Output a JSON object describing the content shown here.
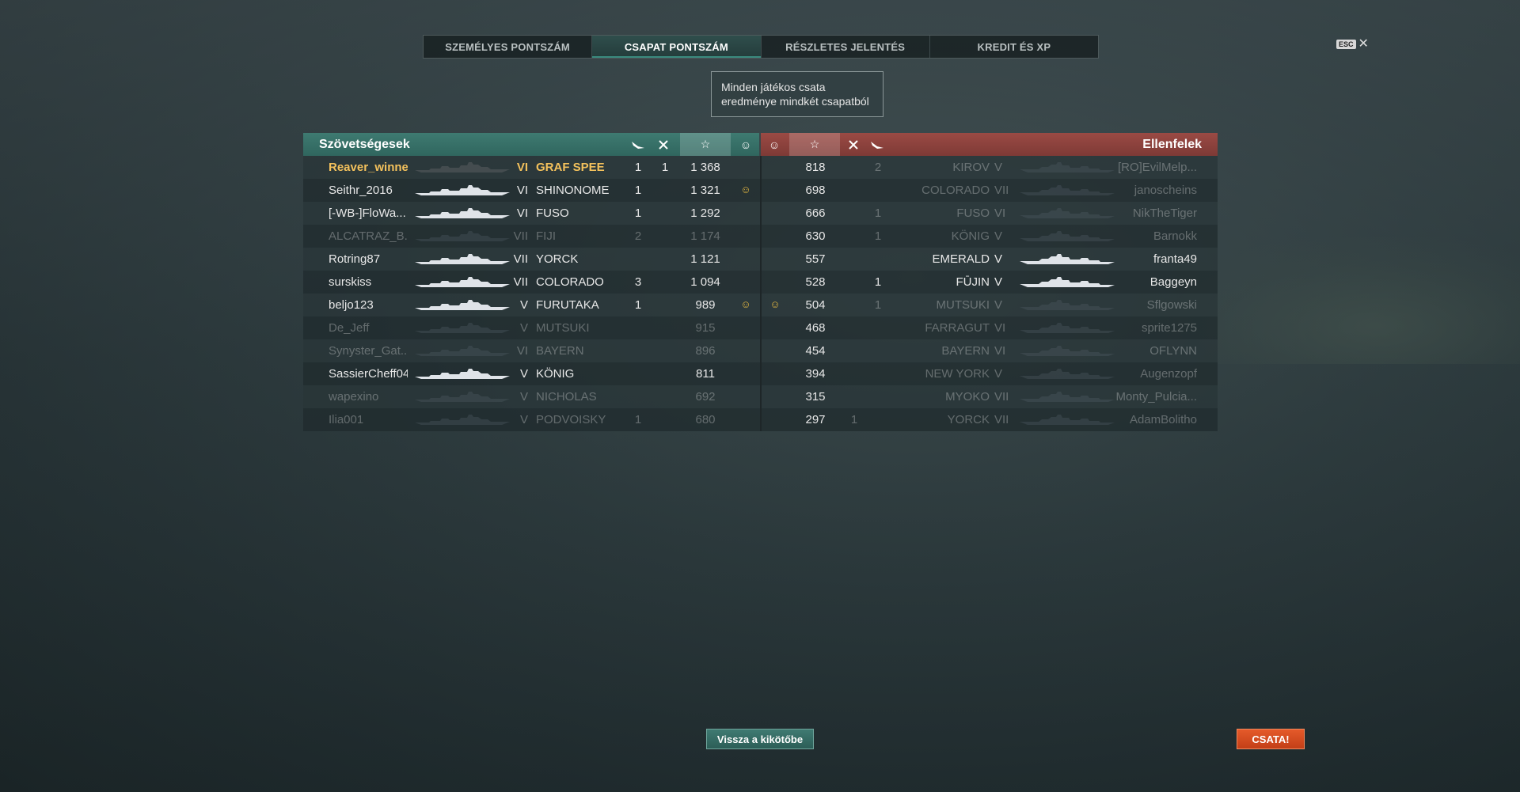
{
  "tabs": [
    {
      "label": "SZEMÉLYES PONTSZÁM",
      "active": false
    },
    {
      "label": "CSAPAT PONTSZÁM",
      "active": true
    },
    {
      "label": "RÉSZLETES JELENTÉS",
      "active": false
    },
    {
      "label": "KREDIT ÉS XP",
      "active": false
    }
  ],
  "esc": {
    "key": "ESC",
    "close": "✕"
  },
  "tooltip": "Minden játékos csata eredménye mindkét csapatból",
  "allies": {
    "title": "Szövetségesek",
    "rows": [
      {
        "player": "Reaver_winner",
        "tier": "VI",
        "ship": "GRAF SPEE",
        "planes": "1",
        "kills": "1",
        "xp": "1 368",
        "medal": "",
        "state": "me"
      },
      {
        "player": "Seithr_2016",
        "tier": "VI",
        "ship": "SHINONOME",
        "planes": "1",
        "kills": "",
        "xp": "1 321",
        "medal": "☺",
        "state": "alive"
      },
      {
        "player": "[-WB-]FloWa...",
        "tier": "VI",
        "ship": "FUSO",
        "planes": "1",
        "kills": "",
        "xp": "1 292",
        "medal": "",
        "state": "alive"
      },
      {
        "player": "ALCATRAZ_B...",
        "tier": "VII",
        "ship": "FIJI",
        "planes": "2",
        "kills": "",
        "xp": "1 174",
        "medal": "",
        "state": "dead"
      },
      {
        "player": "Rotring87",
        "tier": "VII",
        "ship": "YORCK",
        "planes": "",
        "kills": "",
        "xp": "1 121",
        "medal": "",
        "state": "alive"
      },
      {
        "player": "surskiss",
        "tier": "VII",
        "ship": "COLORADO",
        "planes": "3",
        "kills": "",
        "xp": "1 094",
        "medal": "",
        "state": "alive"
      },
      {
        "player": "beljo123",
        "tier": "V",
        "ship": "FURUTAKA",
        "planes": "1",
        "kills": "",
        "xp": "989",
        "medal": "☺",
        "state": "alive"
      },
      {
        "player": "De_Jeff",
        "tier": "V",
        "ship": "MUTSUKI",
        "planes": "",
        "kills": "",
        "xp": "915",
        "medal": "",
        "state": "dead"
      },
      {
        "player": "Synyster_Gat...",
        "tier": "VI",
        "ship": "BAYERN",
        "planes": "",
        "kills": "",
        "xp": "896",
        "medal": "",
        "state": "dead"
      },
      {
        "player": "SassierCheff04",
        "tier": "V",
        "ship": "KÖNIG",
        "planes": "",
        "kills": "",
        "xp": "811",
        "medal": "",
        "state": "alive"
      },
      {
        "player": "wapexino",
        "tier": "V",
        "ship": "NICHOLAS",
        "planes": "",
        "kills": "",
        "xp": "692",
        "medal": "",
        "state": "dead"
      },
      {
        "player": "Ilia001",
        "tier": "V",
        "ship": "PODVOISKY",
        "planes": "1",
        "kills": "",
        "xp": "680",
        "medal": "",
        "state": "dead"
      }
    ]
  },
  "enemies": {
    "title": "Ellenfelek",
    "rows": [
      {
        "player": "[RO]EvilMelp...",
        "tier": "V",
        "ship": "KIROV",
        "planes": "2",
        "kills": "",
        "xp": "818",
        "medal": "",
        "state": "dead"
      },
      {
        "player": "janoscheins",
        "tier": "VII",
        "ship": "COLORADO",
        "planes": "",
        "kills": "",
        "xp": "698",
        "medal": "",
        "state": "dead"
      },
      {
        "player": "NikTheTiger",
        "tier": "VI",
        "ship": "FUSO",
        "planes": "1",
        "kills": "",
        "xp": "666",
        "medal": "",
        "state": "dead"
      },
      {
        "player": "Barnokk",
        "tier": "V",
        "ship": "KÖNIG",
        "planes": "1",
        "kills": "",
        "xp": "630",
        "medal": "",
        "state": "dead"
      },
      {
        "player": "franta49",
        "tier": "V",
        "ship": "EMERALD",
        "planes": "",
        "kills": "",
        "xp": "557",
        "medal": "",
        "state": "alive"
      },
      {
        "player": "Baggeyn",
        "tier": "V",
        "ship": "FŪJIN",
        "planes": "1",
        "kills": "",
        "xp": "528",
        "medal": "",
        "state": "alive"
      },
      {
        "player": "Sflgowski",
        "tier": "V",
        "ship": "MUTSUKI",
        "planes": "1",
        "kills": "",
        "xp": "504",
        "medal": "☺",
        "state": "dead"
      },
      {
        "player": "sprite1275",
        "tier": "VI",
        "ship": "FARRAGUT",
        "planes": "",
        "kills": "",
        "xp": "468",
        "medal": "",
        "state": "dead"
      },
      {
        "player": "OFLYNN",
        "tier": "VI",
        "ship": "BAYERN",
        "planes": "",
        "kills": "",
        "xp": "454",
        "medal": "",
        "state": "dead"
      },
      {
        "player": "Augenzopf",
        "tier": "V",
        "ship": "NEW YORK",
        "planes": "",
        "kills": "",
        "xp": "394",
        "medal": "",
        "state": "dead"
      },
      {
        "player": "Monty_Pulcia...",
        "tier": "VII",
        "ship": "MYOKO",
        "planes": "",
        "kills": "",
        "xp": "315",
        "medal": "",
        "state": "dead"
      },
      {
        "player": "AdamBolitho",
        "tier": "VII",
        "ship": "YORCK",
        "planes": "",
        "kills": "1",
        "xp": "297",
        "medal": "",
        "state": "dead"
      }
    ]
  },
  "buttons": {
    "back": "Vissza a kikötőbe",
    "battle": "CSATA!"
  },
  "colors": {
    "ally_header": "#3e7a71",
    "enemy_header": "#9a4a44",
    "me": "#f3c15c",
    "battle": "#e55a2a"
  }
}
